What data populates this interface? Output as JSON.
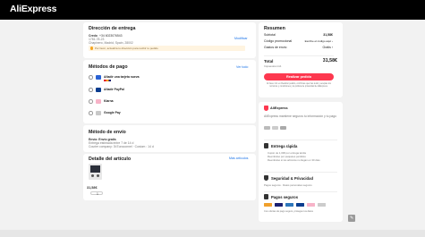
{
  "header": {
    "logo": "AliExpress"
  },
  "shipping": {
    "title": "Dirección de entrega",
    "name": "Credo",
    "phone": "+34 6023076543",
    "street": "1781-78-23",
    "city": "Chapinero, Madrid, Spain, 28002",
    "edit_label": "Modificar",
    "warning": "Por favor, actualiza tu dirección para recibir tu pedido"
  },
  "payment": {
    "title": "Métodos de pago",
    "see_all": "Ver todo",
    "methods": [
      {
        "label": "Añadir una tarjeta nueva",
        "icon": "card-icon",
        "color": "#2a62d4"
      },
      {
        "label": "Añadir PayPal",
        "icon": "paypal-icon",
        "color": "#0a3d8f"
      },
      {
        "label": "Klarna",
        "icon": "klarna-icon",
        "color": "#f7b3c8"
      },
      {
        "label": "Google Pay",
        "icon": "google-pay-icon",
        "color": "#c8c8c8"
      }
    ]
  },
  "delivery": {
    "title": "Método de envío",
    "option": "Envío: Envío gratis",
    "eta": "Entrega estimada entre 7 de 14 d",
    "carrier": "Courier company: 3t Euroconnel · Custom : 14 d"
  },
  "items": {
    "title": "Detalle del artículo",
    "more": "Más artículos",
    "price": "31,58€",
    "quantity": "1"
  },
  "summary": {
    "title": "Resumen",
    "rows": [
      {
        "label": "Subtotal",
        "value": "31,58€"
      },
      {
        "label": "Código promocional",
        "value": "Escribe el código aquí ›"
      },
      {
        "label": "Gastos de envío",
        "value": "Gratis ›"
      }
    ],
    "total_label": "Total",
    "total_value": "31,58€",
    "total_note": "Impuestos incl.",
    "button": "Realizar pedido",
    "terms": "Al hacer clic en Realizar pedido, confirmas que has leído y aceptas los términos y condiciones y la política de privacidad de AliExpress."
  },
  "security": {
    "brand": "AliExpress",
    "text": "AliExpress mantiene seguros tu información y tu pago",
    "fast": {
      "title": "Entrega rápida",
      "lines": [
        "Cupón de 1,00€ por entrega tardía",
        "Reembolso por paquetes perdidos",
        "Reembolso si los artículos no llegan en 30 días"
      ]
    },
    "privacy": {
      "title": "Seguridad & Privacidad",
      "line": "Pagos seguros · Datos personales seguros"
    },
    "pay": {
      "title": "Pagos seguros",
      "note": "Con ofertas de pago seguro, proteges tus datos"
    }
  },
  "colors": {
    "accent": "#fd384f",
    "link": "#1a73e8",
    "header": "#000000"
  }
}
